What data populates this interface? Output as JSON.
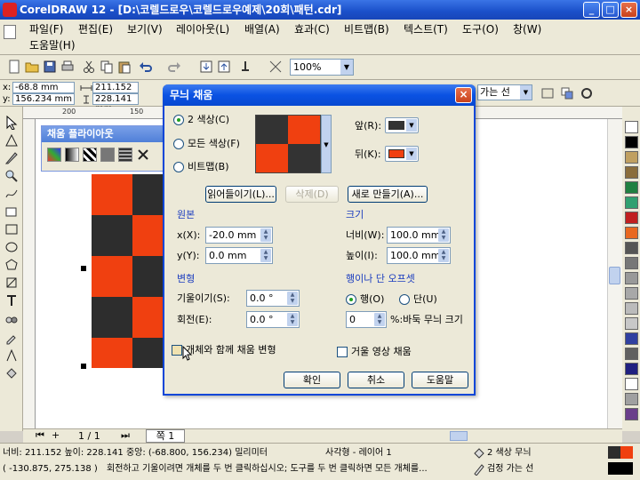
{
  "window": {
    "title": "CorelDRAW 12 - [D:\\코렐드로우\\코렐드로우예제\\20회\\패턴.cdr]",
    "min": "_",
    "max": "□",
    "close": "×"
  },
  "menu": {
    "row1": [
      "파일(F)",
      "편집(E)",
      "보기(V)",
      "레이아웃(L)",
      "배열(A)",
      "효과(C)",
      "비트맵(B)",
      "텍스트(T)",
      "도구(O)",
      "창(W)"
    ],
    "row2": [
      "도움말(H)"
    ]
  },
  "toolbar": {
    "zoom": "100%"
  },
  "propbar": {
    "x_label": "x:",
    "x_value": "-68.8 mm",
    "y_label": "y:",
    "y_value": "156.234 mm",
    "w_value": "211.152 mm",
    "h_value": "228.141 mm",
    "outline": "가는 선"
  },
  "ruler": {
    "ticks": [
      "200",
      "150"
    ]
  },
  "docker": {
    "title": "채움 플라이아웃"
  },
  "palette": [
    "#ffffff",
    "#000000",
    "#c0a060",
    "#8a6d3b",
    "#208040",
    "#30a070",
    "#c02020",
    "#e86820",
    "#555555",
    "#777777",
    "#999999",
    "#a8a8a8",
    "#bbbbbb",
    "#c8c8c8",
    "#3040a0",
    "#606060",
    "#202080",
    "#ffffff",
    "#a0a0a0",
    "#6a3e8a"
  ],
  "checker": {
    "color_a": "#2d2d2d",
    "color_b": "#f04010"
  },
  "dialog": {
    "title": "무늬 채움",
    "close": "×",
    "radio_2color": "2 색상(C)",
    "radio_full": "모든 색상(F)",
    "radio_bitmap": "비트맵(B)",
    "front_label": "앞(R):",
    "back_label": "뒤(K):",
    "front_color": "#333333",
    "back_color": "#f04010",
    "btn_load": "읽어들이기(L)...",
    "btn_delete": "삭제(D)",
    "btn_new": "새로 만들기(A)...",
    "origin_title": "원본",
    "origin_x_label": "x(X):",
    "origin_x": "-20.0 mm",
    "origin_y_label": "y(Y):",
    "origin_y": "0.0 mm",
    "size_title": "크기",
    "width_label": "너비(W):",
    "width": "100.0 mm",
    "height_label": "높이(I):",
    "height": "100.0 mm",
    "transform_title": "변형",
    "skew_label": "기울이기(S):",
    "skew": "0.0 °",
    "rotate_label": "회전(E):",
    "rotate": "0.0 °",
    "offset_title": "행이나 단 오프셋",
    "row_label": "행(O)",
    "col_label": "단(U)",
    "offset_value": "0",
    "offset_suffix": "%:바둑 무늬 크기",
    "chk_transform": "개체와 함께 채움 변형",
    "chk_mirror": "거울 영상 채움",
    "ok": "확인",
    "cancel": "취소",
    "help": "도움말"
  },
  "pagebar": {
    "page_count": "1 / 1",
    "tab": "쪽 1"
  },
  "status": {
    "dims": "너비: 211.152 높이: 228.141 중앙: (-68.800, 156.234) 밀리미터",
    "object": "사각형 - 레이어 1",
    "fill": "2 색상 무늬",
    "coords": "( -130.875, 275.138 )",
    "hint": "회전하고 기울이려면 개체를 두 번 클릭하십시오; 도구를 두 번 클릭하면 모든 개체를...",
    "outline": "검정  가는 선"
  }
}
